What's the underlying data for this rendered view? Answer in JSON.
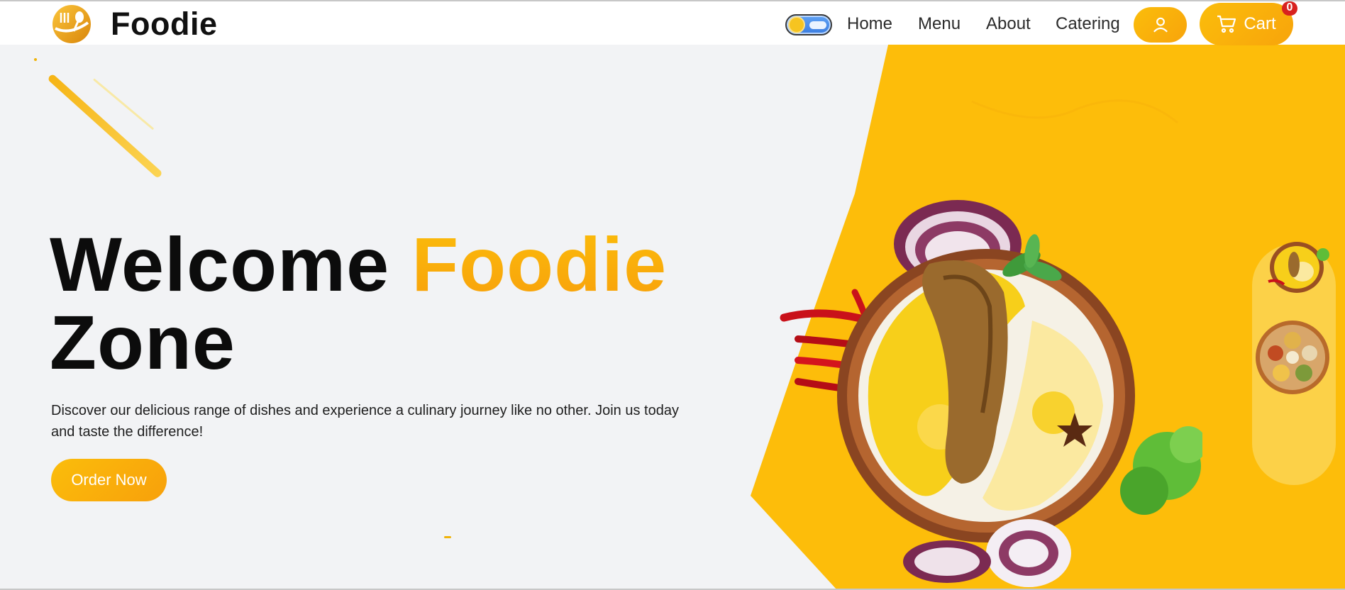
{
  "header": {
    "brand": "Foodie",
    "nav": [
      "Home",
      "Menu",
      "About",
      "Catering"
    ],
    "cart_label": "Cart",
    "cart_count": "0",
    "theme_toggle": "light"
  },
  "hero": {
    "title_part1": "Welcome ",
    "title_accent": "Foodie",
    "title_part2": "Zone",
    "description": "Discover our delicious range of dishes and experience a culinary journey like no other. Join us today and taste the difference!",
    "cta": "Order Now"
  },
  "colors": {
    "accent": "#FBB70B",
    "accent_dark": "#F8A00B",
    "hero_bg": "#F2F3F5",
    "badge": "#D8221F"
  },
  "icons": [
    "logo-icon",
    "user-icon",
    "cart-icon"
  ]
}
